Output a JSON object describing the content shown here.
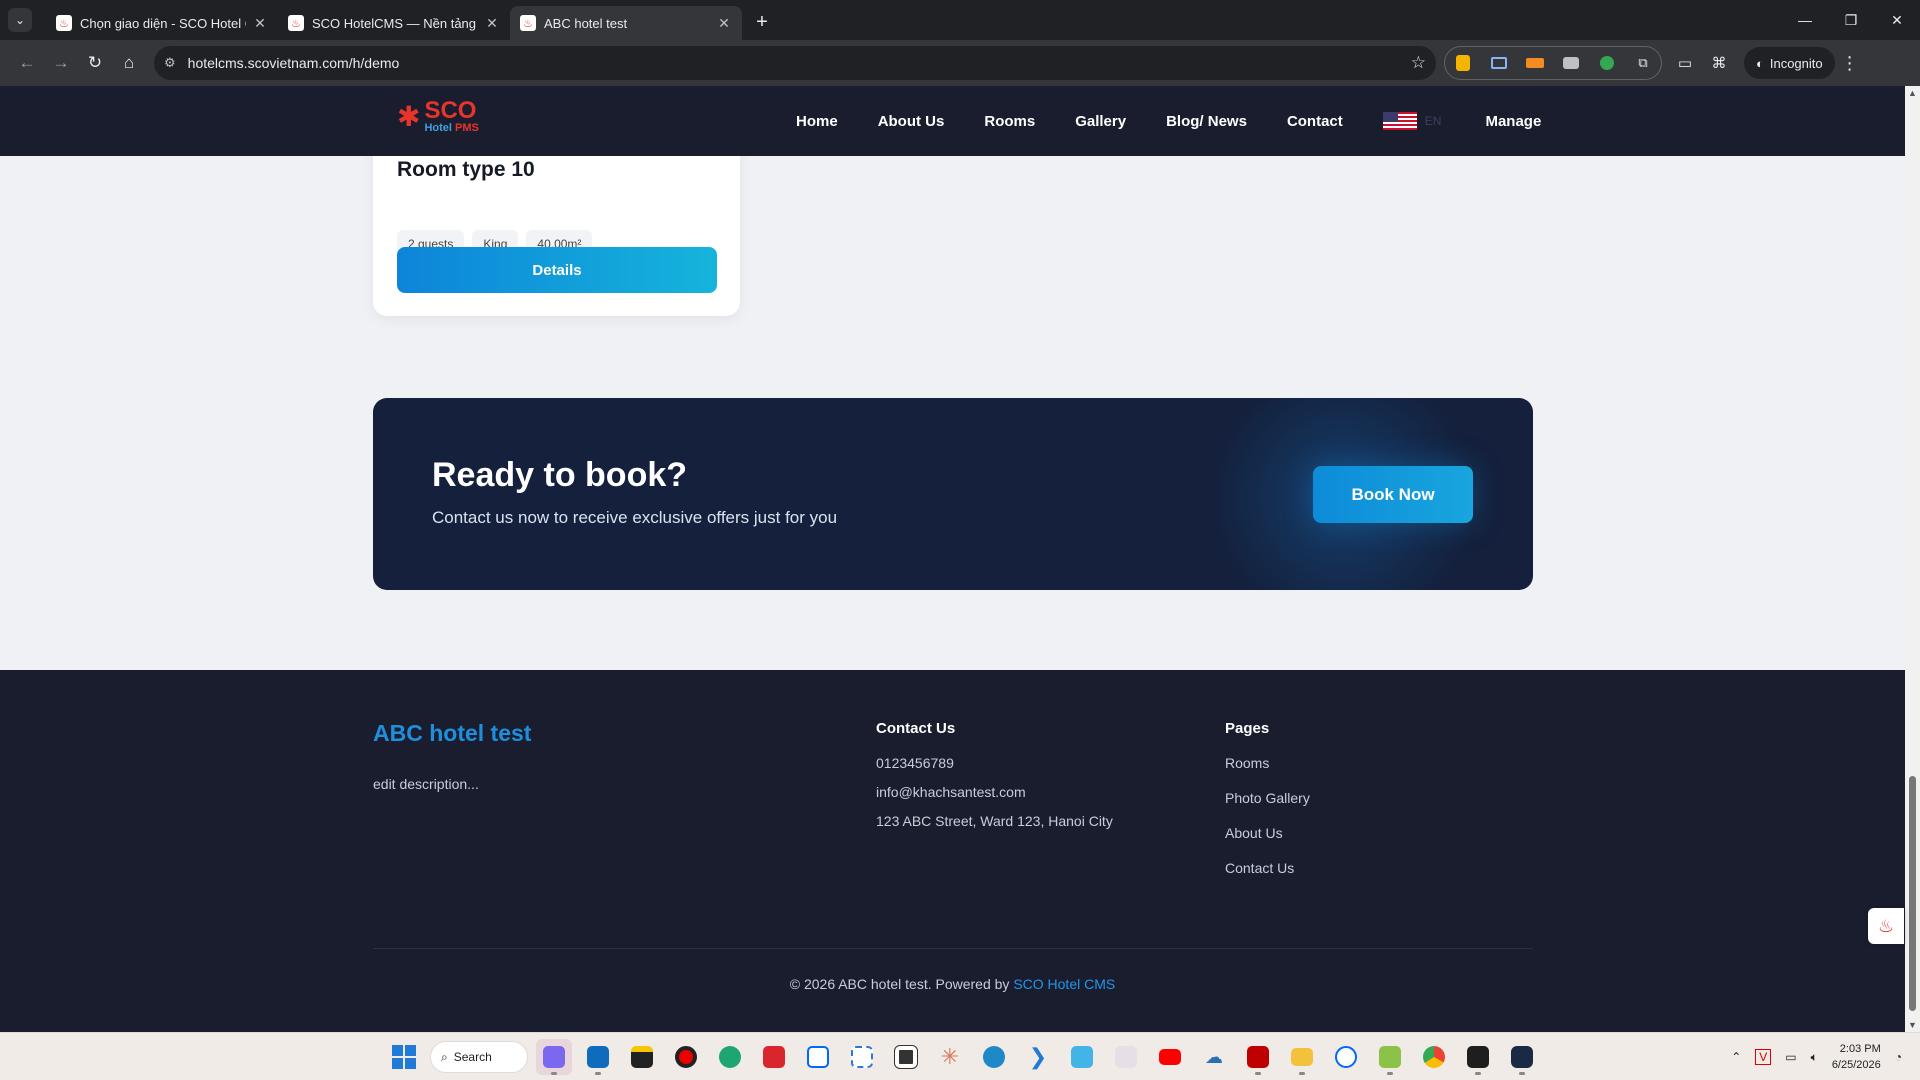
{
  "browser": {
    "tabs": [
      {
        "title": "Chọn giao diện - SCO Hotel CMS",
        "active": false
      },
      {
        "title": "SCO HotelCMS — Nền tảng website",
        "active": false
      },
      {
        "title": "ABC hotel test",
        "active": true
      }
    ],
    "url": "hotelcms.scovietnam.com/h/demo",
    "incognito_label": "Incognito"
  },
  "site": {
    "logo": {
      "name": "SCO",
      "sub_left": "Hotel",
      "sub_right": "PMS"
    },
    "nav": [
      "Home",
      "About Us",
      "Rooms",
      "Gallery",
      "Blog/ News",
      "Contact"
    ],
    "lang_code": "EN",
    "manage_label": "Manage"
  },
  "room": {
    "title": "Room type 10",
    "chips": [
      "2 guests",
      "King",
      "40.00m²"
    ],
    "details_label": "Details"
  },
  "cta": {
    "title": "Ready to book?",
    "subtitle": "Contact us now to receive exclusive offers just for you",
    "button": "Book Now"
  },
  "footer": {
    "brand": "ABC hotel test",
    "description": "edit description...",
    "contact": {
      "heading": "Contact Us",
      "phone": "0123456789",
      "email": "info@khachsantest.com",
      "address": "123 ABC Street, Ward 123, Hanoi City"
    },
    "pages": {
      "heading": "Pages",
      "links": [
        "Rooms",
        "Photo Gallery",
        "About Us",
        "Contact Us"
      ]
    },
    "copyright": "© 2026 ABC hotel test. Powered by ",
    "powered_link": "SCO Hotel CMS"
  },
  "taskbar": {
    "search_label": "Search",
    "time": "2:03 PM",
    "date": "6/25/2026"
  },
  "colors": {
    "nav_bg": "#1a1d2e",
    "accent_blue": "#1e8fdc",
    "cta_bg": "#14203c",
    "logo_red": "#e8352b"
  }
}
